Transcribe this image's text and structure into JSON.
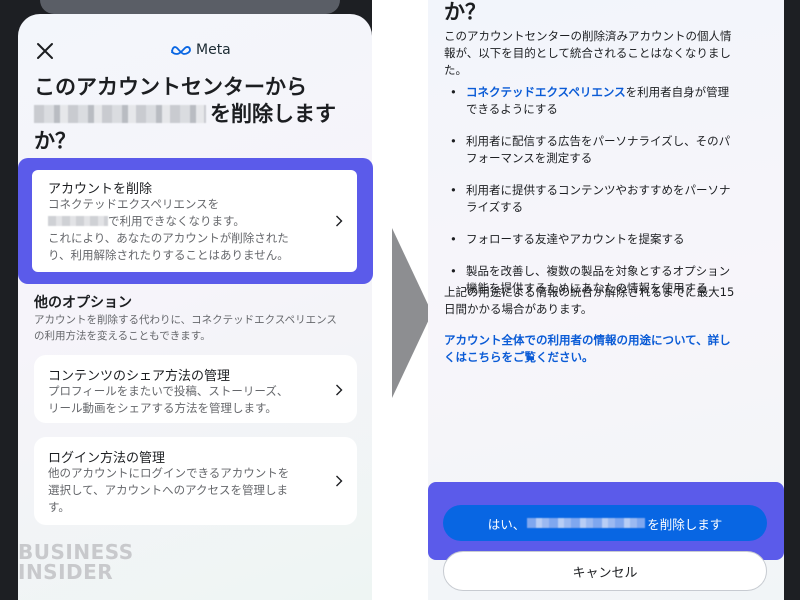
{
  "left": {
    "brand": "Meta",
    "title_part1": "このアカウントセンターから",
    "title_part2": "を削除します",
    "title_part3": "か？",
    "delete_card": {
      "title": "アカウントを削除",
      "body_1": "コネクテッドエクスペリエンスを",
      "body_2": "で利用できなくなります。",
      "body_3": "これにより、あなたのアカウントが削除された",
      "body_4": "り、利用解除されたりすることはありません。"
    },
    "other_options": {
      "title": "他のオプション",
      "desc_1": "アカウントを削除する代わりに、コネクテッドエクスペリエンス",
      "desc_2": "の利用方法を変えることもできます。"
    },
    "share_card": {
      "title": "コンテンツのシェア方法の管理",
      "body_1": "プロフィールをまたいで投稿、ストーリーズ、",
      "body_2": "リール動画をシェアする方法を管理します。"
    },
    "login_card": {
      "title": "ログイン方法の管理",
      "body_1": "他のアカウントにログインできるアカウントを",
      "body_2": "選択して、アカウントへのアクセスを管理しま",
      "body_3": "す。"
    },
    "watermark_1": "BUSINESS",
    "watermark_2": "INSIDER"
  },
  "right": {
    "heading": "か？",
    "intro_1": "このアカウントセンターの削除済みアカウントの個人情",
    "intro_2": "報が、以下を目的として統合されることはなくなりまし",
    "intro_3": "た。",
    "bullets": [
      {
        "link": "コネクテッドエクスペリエンス",
        "text_1": "を利用者自身が管理",
        "text_2": "できるようにする"
      },
      {
        "text_1": "利用者に配信する広告をパーソナライズし、そのパ",
        "text_2": "フォーマンスを測定する"
      },
      {
        "text_1": "利用者に提供するコンテンツやおすすめをパーソナ",
        "text_2": "ライズする"
      },
      {
        "text_1": "フォローする友達やアカウントを提案する"
      },
      {
        "text_1": "製品を改善し、複数の製品を対象とするオプション",
        "text_2": "機能を提供するためにあなたの情報を使用する"
      }
    ],
    "note_1": "上記の用途による情報の統合が解除されるまでに最大15",
    "note_2": "日間かかる場合があります。",
    "learn_1": "アカウント全体での利用者の情報の用途について、詳し",
    "learn_2": "くはこちらをご覧ください。",
    "confirm_prefix": "はい、",
    "confirm_suffix": "を削除します",
    "cancel": "キャンセル"
  },
  "colors": {
    "highlight": "#5b5bea",
    "primary_button": "#0866e3",
    "link": "#0a5bd6"
  }
}
